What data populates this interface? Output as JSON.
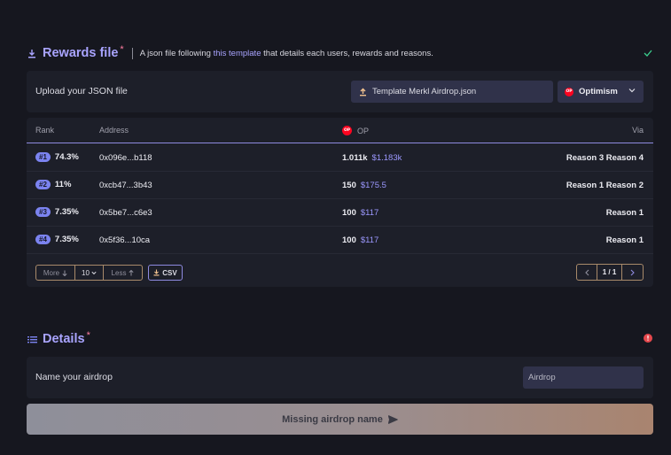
{
  "rewards": {
    "title": "Rewards file",
    "required_mark": "*",
    "description_prefix": "A json file following",
    "description_link": "this template",
    "description_suffix": "that details each users, rewards and reasons.",
    "upload_label": "Upload your JSON file",
    "file_name": "Template Merkl Airdrop.json",
    "network": "Optimism",
    "network_logo_text": "OP"
  },
  "table": {
    "headers": {
      "rank": "Rank",
      "address": "Address",
      "token": "OP",
      "via": "Via"
    },
    "rows": [
      {
        "rank": "#1",
        "pct": "74.3%",
        "address": "0x096e...b118",
        "amount": "1.011k",
        "usd": "$1.183k",
        "via": "Reason 3 Reason 4"
      },
      {
        "rank": "#2",
        "pct": "11%",
        "address": "0xcb47...3b43",
        "amount": "150",
        "usd": "$175.5",
        "via": "Reason 1 Reason 2"
      },
      {
        "rank": "#3",
        "pct": "7.35%",
        "address": "0x5be7...c6e3",
        "amount": "100",
        "usd": "$117",
        "via": "Reason 1"
      },
      {
        "rank": "#4",
        "pct": "7.35%",
        "address": "0x5f36...10ca",
        "amount": "100",
        "usd": "$117",
        "via": "Reason 1"
      }
    ],
    "controls": {
      "more": "More",
      "page_size": "10",
      "less": "Less",
      "csv": "CSV",
      "page": "1 / 1"
    }
  },
  "details": {
    "title": "Details",
    "required_mark": "*",
    "name_label": "Name your airdrop",
    "name_placeholder": "Airdrop",
    "submit_label": "Missing airdrop name"
  },
  "colors": {
    "accent": "#a9a4ff",
    "required": "#ff7da1",
    "success": "#3ccf8e",
    "error": "#e5484d",
    "badge": "#7b83f0"
  },
  "icons": {
    "rewards_section": "download-icon",
    "details_section": "list-icon",
    "status_ok": "check-icon",
    "status_error": "alert-icon",
    "file": "upload-icon",
    "submit": "send-icon"
  }
}
